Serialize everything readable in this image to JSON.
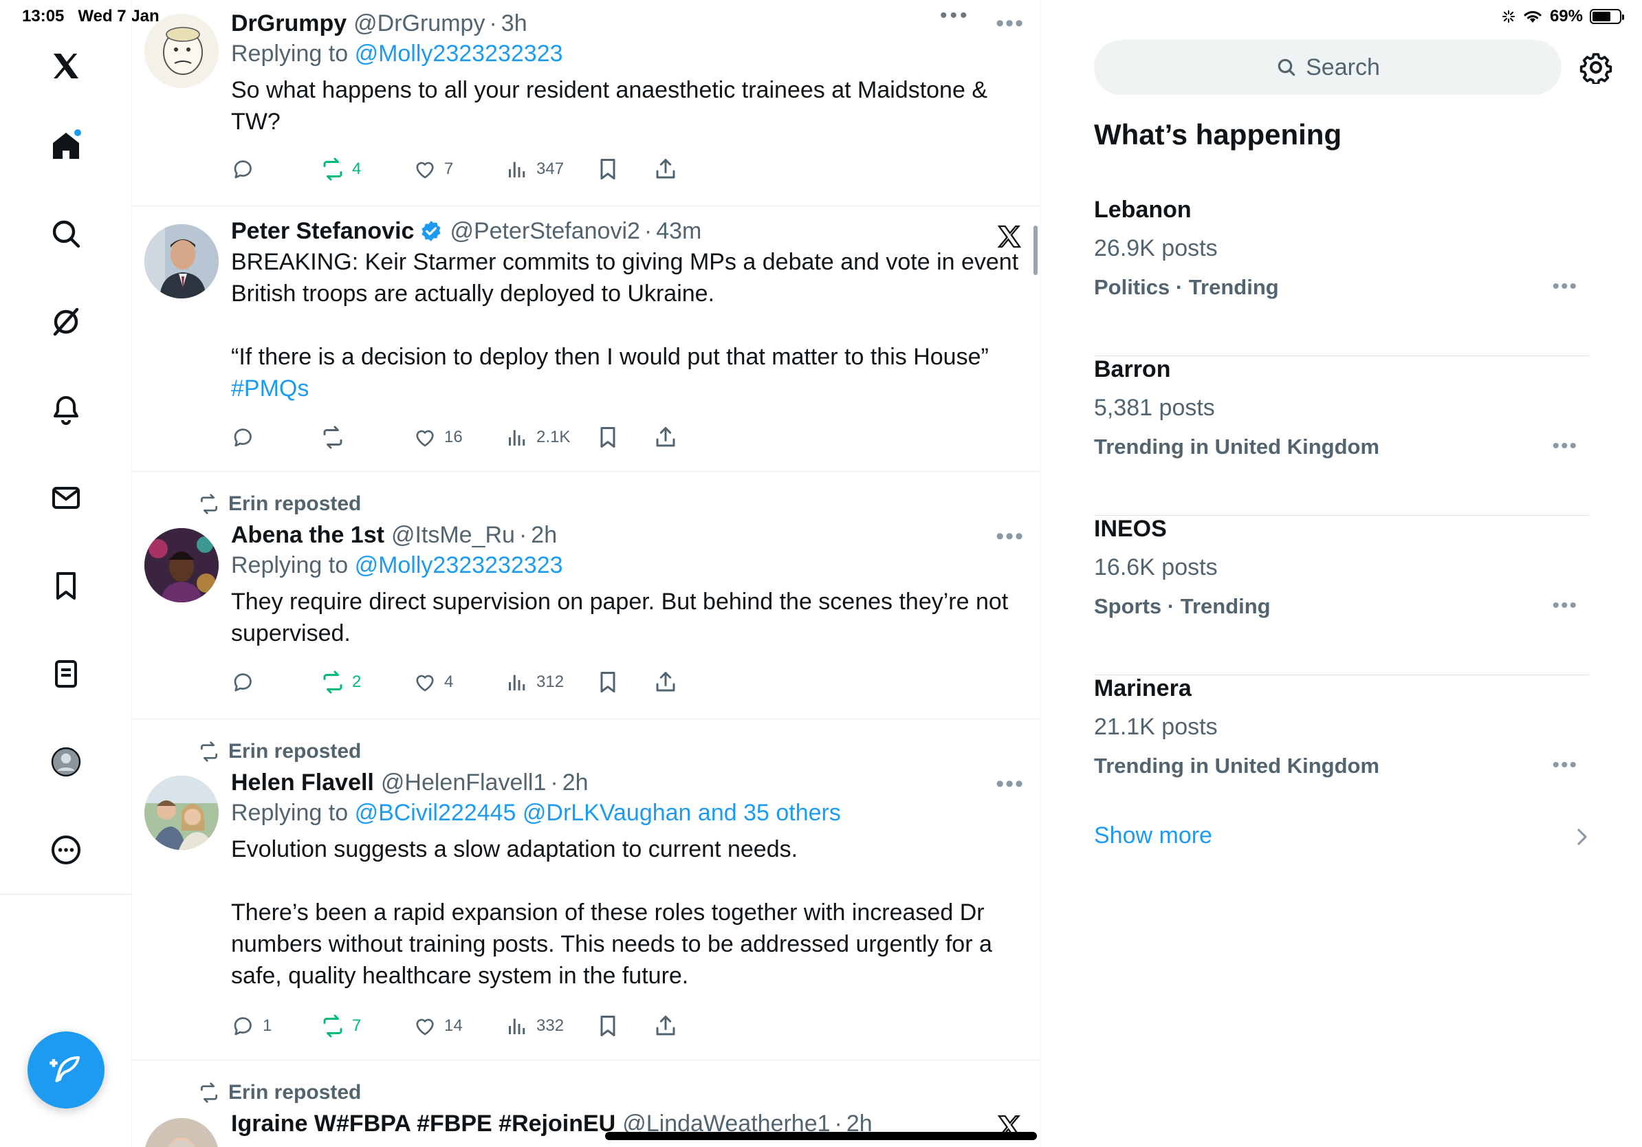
{
  "status_bar": {
    "time": "13:05",
    "date": "Wed 7 Jan",
    "battery": "69%",
    "battery_level": 0.69
  },
  "nav": {
    "items": [
      "x-logo",
      "home",
      "explore",
      "grok",
      "notifications",
      "messages",
      "bookmarks",
      "lists",
      "profile",
      "more"
    ],
    "compose_label": "Post"
  },
  "timeline": {
    "tweets": [
      {
        "name": "DrGrumpy",
        "handle": "@DrGrumpy",
        "sep": "·",
        "time": "3h",
        "replying_prefix": "Replying to",
        "replying_to": "@Molly2323232323",
        "text": "So what happens to all your resident anaesthetic trainees at Maidstone & TW?",
        "replies": "",
        "reposts": "4",
        "likes": "7",
        "views": "347"
      },
      {
        "name": "Peter Stefanovic",
        "handle": "@PeterStefanovi2",
        "sep": "·",
        "time": "43m",
        "text": "BREAKING: Keir Starmer commits to giving MPs a debate and vote in event British troops are actually deployed to Ukraine.\n\n“If there is a decision to deploy then I would put that matter to this House”",
        "hashtag": "#PMQs",
        "replies": "",
        "reposts": "",
        "likes": "16",
        "views": "2.1K"
      },
      {
        "reposted_by": "Erin reposted",
        "name": "Abena the 1st",
        "handle": "@ItsMe_Ru",
        "sep": "·",
        "time": "2h",
        "replying_prefix": "Replying to",
        "replying_to": "@Molly2323232323",
        "text": "They require direct supervision on paper. But behind the scenes they’re not supervised.",
        "replies": "",
        "reposts": "2",
        "likes": "4",
        "views": "312"
      },
      {
        "reposted_by": "Erin reposted",
        "name": "Helen Flavell",
        "handle": "@HelenFlavell1",
        "sep": "·",
        "time": "2h",
        "replying_prefix": "Replying to",
        "replying_to": "@BCivil222445 @DrLKVaughan and 35 others",
        "text": "Evolution suggests a slow adaptation to current needs.\n\nThere’s been a rapid expansion of these roles together with increased Dr numbers without training posts. This needs to be addressed urgently for a safe, quality healthcare system in the  future.",
        "replies": "1",
        "reposts": "7",
        "likes": "14",
        "views": "332"
      },
      {
        "reposted_by": "Erin reposted",
        "name": "Igraine W#FBPA #FBPE #RejoinEU",
        "handle": "@LindaWeatherhe1",
        "sep": "·",
        "time": "2h"
      }
    ]
  },
  "sidebar": {
    "search_placeholder": "Search",
    "title": "What’s happening",
    "trends": [
      {
        "name": "Lebanon",
        "posts": "26.9K posts",
        "category": "Politics · Trending"
      },
      {
        "name": "Barron",
        "posts": "5,381 posts",
        "category": "Trending in United Kingdom"
      },
      {
        "name": "INEOS",
        "posts": "16.6K posts",
        "category": "Sports · Trending"
      },
      {
        "name": "Marinera",
        "posts": "21.1K posts",
        "category": "Trending in United Kingdom"
      }
    ],
    "show_more": "Show more"
  },
  "colors": {
    "accent": "#1d9bf0",
    "repost_green": "#00ba7c",
    "muted": "#536471"
  }
}
